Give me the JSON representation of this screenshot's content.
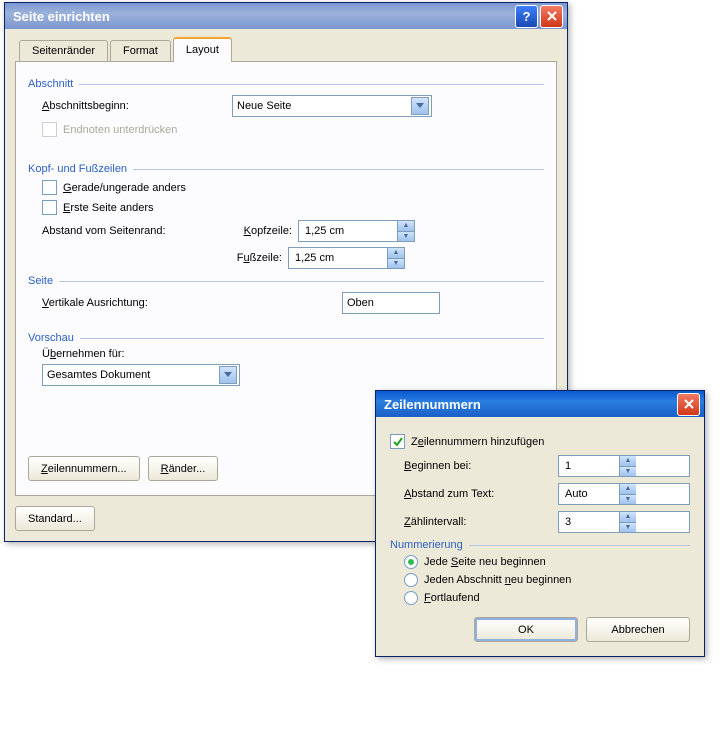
{
  "dlg1": {
    "title": "Seite einrichten",
    "tabs": [
      "Seitenränder",
      "Format",
      "Layout"
    ],
    "active_tab": 2,
    "section": {
      "heading": "Abschnitt",
      "begin_label": "Abschnittsbeginn:",
      "begin_value": "Neue Seite",
      "endnote_label": "Endnoten unterdrücken"
    },
    "headerfooter": {
      "heading": "Kopf- und Fußzeilen",
      "odd_even_label": "Gerade/ungerade anders",
      "first_page_label": "Erste Seite anders",
      "distance_label": "Abstand vom Seitenrand:",
      "header_label": "Kopfzeile:",
      "header_value": "1,25 cm",
      "footer_label": "Fußzeile:",
      "footer_value": "1,25 cm"
    },
    "page": {
      "heading": "Seite",
      "valign_label": "Vertikale Ausrichtung:",
      "valign_value": "Oben"
    },
    "preview": {
      "heading": "Vorschau",
      "apply_label": "Übernehmen für:",
      "apply_value": "Gesamtes Dokument"
    },
    "buttons": {
      "linenumbers": "Zeilennummern...",
      "borders": "Ränder...",
      "default": "Standard..."
    }
  },
  "dlg2": {
    "title": "Zeilennummern",
    "add_label": "Zeilennummern hinzufügen",
    "start_label": "Beginnen bei:",
    "start_value": "1",
    "distance_label": "Abstand zum Text:",
    "distance_value": "Auto",
    "interval_label": "Zählintervall:",
    "interval_value": "3",
    "numbering_heading": "Nummerierung",
    "opts": {
      "each_page": "Jede Seite neu beginnen",
      "each_section": "Jeden Abschnitt neu beginnen",
      "continuous": "Fortlaufend"
    },
    "ok": "OK",
    "cancel": "Abbrechen"
  }
}
